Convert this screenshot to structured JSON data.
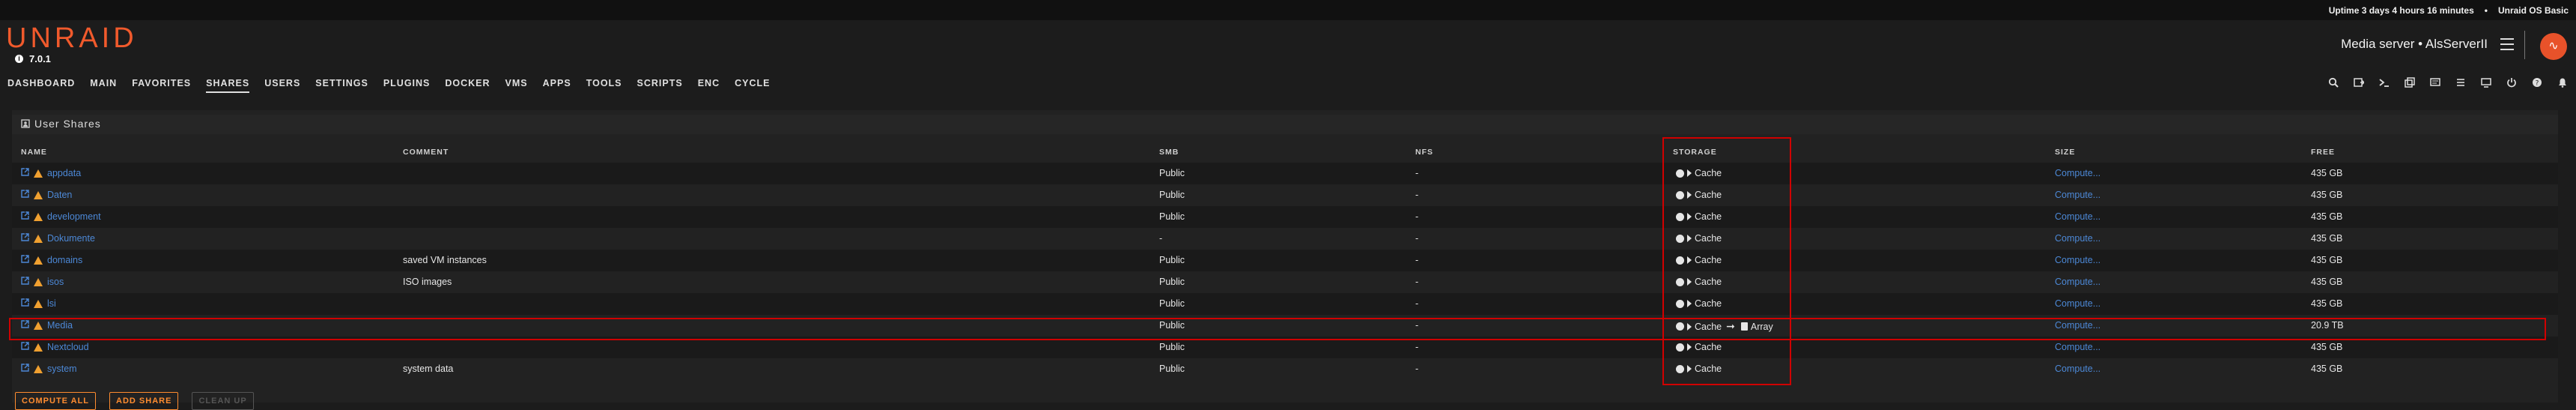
{
  "status": {
    "uptime": "Uptime 3 days 4 hours 16 minutes",
    "edition": "Unraid OS Basic"
  },
  "header": {
    "logo": "UNRAID",
    "version": "7.0.1",
    "server": "Media server • AlsServerII"
  },
  "nav": {
    "items": [
      "DASHBOARD",
      "MAIN",
      "FAVORITES",
      "SHARES",
      "USERS",
      "SETTINGS",
      "PLUGINS",
      "DOCKER",
      "VMS",
      "APPS",
      "TOOLS",
      "SCRIPTS",
      "ENC",
      "CYCLE"
    ],
    "active": "SHARES",
    "tools": [
      "search-icon",
      "logs-icon",
      "terminal-icon",
      "new-window-icon",
      "feedback-icon",
      "log-file-icon",
      "display-icon",
      "power-icon",
      "help-icon",
      "notifications-icon"
    ]
  },
  "panel": {
    "title": "User Shares",
    "columns": {
      "name": "NAME",
      "comment": "COMMENT",
      "smb": "SMB",
      "nfs": "NFS",
      "storage": "STORAGE",
      "size": "SIZE",
      "free": "FREE"
    },
    "rows": [
      {
        "name": "appdata",
        "comment": "",
        "smb": "Public",
        "nfs": "-",
        "storage": "Cache",
        "secondary": "",
        "size": "Compute...",
        "free": "435 GB"
      },
      {
        "name": "Daten",
        "comment": "",
        "smb": "Public",
        "nfs": "-",
        "storage": "Cache",
        "secondary": "",
        "size": "Compute...",
        "free": "435 GB"
      },
      {
        "name": "development",
        "comment": "",
        "smb": "Public",
        "nfs": "-",
        "storage": "Cache",
        "secondary": "",
        "size": "Compute...",
        "free": "435 GB"
      },
      {
        "name": "Dokumente",
        "comment": "",
        "smb": "-",
        "nfs": "-",
        "storage": "Cache",
        "secondary": "",
        "size": "Compute...",
        "free": "435 GB"
      },
      {
        "name": "domains",
        "comment": "saved VM instances",
        "smb": "Public",
        "nfs": "-",
        "storage": "Cache",
        "secondary": "",
        "size": "Compute...",
        "free": "435 GB"
      },
      {
        "name": "isos",
        "comment": "ISO images",
        "smb": "Public",
        "nfs": "-",
        "storage": "Cache",
        "secondary": "",
        "size": "Compute...",
        "free": "435 GB"
      },
      {
        "name": "lsi",
        "comment": "",
        "smb": "Public",
        "nfs": "-",
        "storage": "Cache",
        "secondary": "",
        "size": "Compute...",
        "free": "435 GB"
      },
      {
        "name": "Media",
        "comment": "",
        "smb": "Public",
        "nfs": "-",
        "storage": "Cache",
        "secondary": "Array",
        "size": "Compute...",
        "free": "20.9 TB"
      },
      {
        "name": "Nextcloud",
        "comment": "",
        "smb": "Public",
        "nfs": "-",
        "storage": "Cache",
        "secondary": "",
        "size": "Compute...",
        "free": "435 GB"
      },
      {
        "name": "system",
        "comment": "system data",
        "smb": "Public",
        "nfs": "-",
        "storage": "Cache",
        "secondary": "",
        "size": "Compute...",
        "free": "435 GB"
      }
    ]
  },
  "buttons": {
    "compute_all": "COMPUTE ALL",
    "add_share": "ADD SHARE",
    "clean_up": "CLEAN UP"
  },
  "colors": {
    "accent": "#f15a2c",
    "link": "#4c88d6",
    "warning": "#f0a030",
    "highlight": "#d00000"
  }
}
